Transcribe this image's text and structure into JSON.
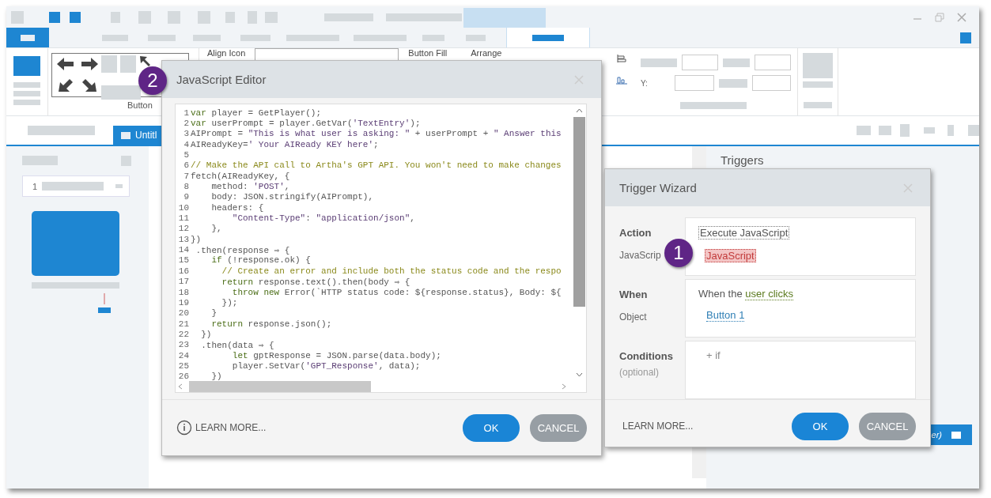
{
  "ribbon": {
    "group_label": "Button",
    "align_icon": "Align Icon",
    "button_fill": "Button Fill",
    "arrange": "Arrange",
    "y_label": "Y:"
  },
  "doc_tabs": [
    {
      "label": "Untitl",
      "selected": true
    }
  ],
  "slide_panel": {
    "slide_number": "1"
  },
  "triggers_panel": {
    "title": "Triggers",
    "selected_row_text": "er)"
  },
  "js_editor": {
    "title": "JavaScript Editor",
    "badge": "2",
    "lines": [
      {
        "n": "1",
        "tokens": [
          {
            "kind": "kw",
            "t": "var"
          },
          {
            "kind": "txt",
            "t": " player = GetPlayer();"
          }
        ]
      },
      {
        "n": "2",
        "tokens": [
          {
            "kind": "kw",
            "t": "var"
          },
          {
            "kind": "txt",
            "t": " userPrompt = player.GetVar("
          },
          {
            "kind": "str",
            "t": "'TextEntry'"
          },
          {
            "kind": "txt",
            "t": ");"
          }
        ]
      },
      {
        "n": "3",
        "tokens": [
          {
            "kind": "txt",
            "t": "AIPrompt = "
          },
          {
            "kind": "str",
            "t": "\"This is what user is asking: \""
          },
          {
            "kind": "txt",
            "t": " + userPrompt + "
          },
          {
            "kind": "str",
            "t": "\" Answer this"
          }
        ]
      },
      {
        "n": "4",
        "tokens": [
          {
            "kind": "txt",
            "t": "AIReadyKey="
          },
          {
            "kind": "str",
            "t": "' Your AIReady KEY here'"
          },
          {
            "kind": "txt",
            "t": ";"
          }
        ]
      },
      {
        "n": "5"
      },
      {
        "n": "6",
        "tokens": [
          {
            "kind": "cmt",
            "t": "// Make the API call to Artha's GPT API. You won't need to make changes"
          }
        ]
      },
      {
        "n": "7",
        "tokens": [
          {
            "kind": "txt",
            "t": "fetch(AIReadyKey, {"
          }
        ]
      },
      {
        "n": "8",
        "tokens": [
          {
            "kind": "txt",
            "t": "    method: "
          },
          {
            "kind": "str",
            "t": "'POST'"
          },
          {
            "kind": "txt",
            "t": ","
          }
        ]
      },
      {
        "n": "9",
        "tokens": [
          {
            "kind": "txt",
            "t": "    body: JSON.stringify(AIPrompt),"
          }
        ]
      },
      {
        "n": "10",
        "tokens": [
          {
            "kind": "txt",
            "t": "    headers: {"
          }
        ]
      },
      {
        "n": "11",
        "tokens": [
          {
            "kind": "str",
            "t": "        \"Content-Type\""
          },
          {
            "kind": "txt",
            "t": ": "
          },
          {
            "kind": "str",
            "t": "\"application/json\""
          },
          {
            "kind": "txt",
            "t": ","
          }
        ]
      },
      {
        "n": "12",
        "tokens": [
          {
            "kind": "txt",
            "t": "    },"
          }
        ]
      },
      {
        "n": "13",
        "tokens": [
          {
            "kind": "txt",
            "t": "})"
          }
        ]
      },
      {
        "n": "14",
        "tokens": [
          {
            "kind": "txt",
            "t": " .then(response ⇒ {"
          }
        ]
      },
      {
        "n": "15",
        "tokens": [
          {
            "kind": "kw",
            "t": "    if"
          },
          {
            "kind": "txt",
            "t": " (!response.ok) {"
          }
        ]
      },
      {
        "n": "16",
        "tokens": [
          {
            "kind": "cmt",
            "t": "      // Create an error and include both the status code and the respo"
          }
        ]
      },
      {
        "n": "17",
        "tokens": [
          {
            "kind": "kw",
            "t": "      return"
          },
          {
            "kind": "txt",
            "t": " response.text().then(body ⇒ {"
          }
        ]
      },
      {
        "n": "18",
        "tokens": [
          {
            "kind": "kw",
            "t": "        throw new"
          },
          {
            "kind": "txt",
            "t": " Error(`HTTP status code: ${response.status}, Body: ${"
          }
        ]
      },
      {
        "n": "19",
        "tokens": [
          {
            "kind": "txt",
            "t": "      });"
          }
        ]
      },
      {
        "n": "20",
        "tokens": [
          {
            "kind": "txt",
            "t": "    }"
          }
        ]
      },
      {
        "n": "21",
        "tokens": [
          {
            "kind": "kw",
            "t": "    return"
          },
          {
            "kind": "txt",
            "t": " response.json();"
          }
        ]
      },
      {
        "n": "22",
        "tokens": [
          {
            "kind": "txt",
            "t": "  })"
          }
        ]
      },
      {
        "n": "23",
        "tokens": [
          {
            "kind": "txt",
            "t": "  .then(data ⇒ {"
          }
        ]
      },
      {
        "n": "24",
        "tokens": [
          {
            "kind": "kw",
            "t": "        let"
          },
          {
            "kind": "txt",
            "t": " gptResponse = JSON.parse(data.body);"
          }
        ]
      },
      {
        "n": "25",
        "tokens": [
          {
            "kind": "txt",
            "t": "        player.SetVar("
          },
          {
            "kind": "str",
            "t": "'GPT_Response'"
          },
          {
            "kind": "txt",
            "t": ", data);"
          }
        ]
      },
      {
        "n": "26",
        "tokens": [
          {
            "kind": "txt",
            "t": "    })"
          }
        ]
      }
    ],
    "learn_more": "LEARN MORE...",
    "ok": "OK",
    "cancel": "CANCEL"
  },
  "trigger_wizard": {
    "title": "Trigger Wizard",
    "badge": "1",
    "sections": [
      {
        "label": "Action",
        "value": {
          "kind": "dotted",
          "text": "Execute JavaScript"
        },
        "rows": [
          {
            "label": "JavaScrip",
            "value": {
              "kind": "error",
              "text": "JavaScript"
            }
          }
        ]
      },
      {
        "label": "When",
        "value": {
          "kind": "phrase",
          "text": "When the",
          "link": "user clicks"
        },
        "rows": [
          {
            "label": "Object",
            "value": {
              "kind": "link",
              "text": "Button 1"
            }
          }
        ]
      },
      {
        "label": "Conditions",
        "note": "(optional)",
        "value": {
          "kind": "add",
          "text": "+ if"
        }
      }
    ],
    "learn_more": "LEARN MORE...",
    "ok": "OK",
    "cancel": "CANCEL"
  }
}
